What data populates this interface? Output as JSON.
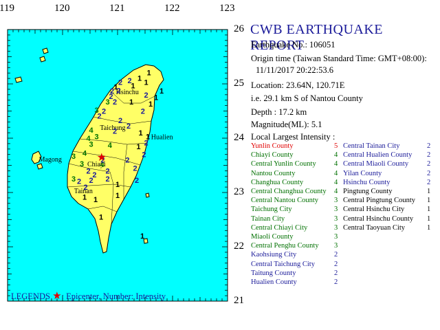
{
  "axes": {
    "longitudes": [
      "119",
      "120",
      "121",
      "122",
      "123"
    ],
    "latitudes": [
      "26",
      "25",
      "24",
      "23",
      "22",
      "21"
    ]
  },
  "report": {
    "title": "CWB EARTHQUAKE REPORT",
    "earthquake_no": "Earthquake No.: 106051",
    "origin_time_label": "Origin time (Taiwan Standard Time: GMT+08:00):",
    "origin_time": "11/11/2017 20:22:53.6",
    "location": "Location: 23.64N, 120.71E",
    "relative_location": "i.e. 29.1 km S of Nantou County",
    "depth": "Depth : 17.2 km",
    "magnitude": "Magnitude(ML): 5.1",
    "intensity_header": "Local Largest Intensity :"
  },
  "colors": {
    "sea": "#00ffff",
    "land": "#ffff66",
    "max_intensity": "#e00000",
    "intensity_4": "#007000",
    "intensity_3": "#007000",
    "intensity_2": "#1a1a99",
    "intensity_1": "#000000"
  },
  "intensities_left": [
    {
      "name": "Yunlin County",
      "value": "5",
      "level": 5
    },
    {
      "name": "Chiayi County",
      "value": "4",
      "level": 4
    },
    {
      "name": "Central Yunlin County",
      "value": "4",
      "level": 4
    },
    {
      "name": "Nantou County",
      "value": "4",
      "level": 4
    },
    {
      "name": "Changhua County",
      "value": "4",
      "level": 4
    },
    {
      "name": "Central Changhua County",
      "value": "4",
      "level": 4
    },
    {
      "name": "Central Nantou County",
      "value": "3",
      "level": 3
    },
    {
      "name": "Taichung City",
      "value": "3",
      "level": 3
    },
    {
      "name": "Tainan City",
      "value": "3",
      "level": 3
    },
    {
      "name": "Central Chiayi City",
      "value": "3",
      "level": 3
    },
    {
      "name": "Miaoli County",
      "value": "3",
      "level": 3
    },
    {
      "name": "Central Penghu County",
      "value": "3",
      "level": 3
    },
    {
      "name": "Kaohsiung City",
      "value": "2",
      "level": 2
    },
    {
      "name": "Central Taichung City",
      "value": "2",
      "level": 2
    },
    {
      "name": "Taitung County",
      "value": "2",
      "level": 2
    },
    {
      "name": "Hualien County",
      "value": "2",
      "level": 2
    }
  ],
  "intensities_right": [
    {
      "name": "Central Tainan City",
      "value": "2",
      "level": 2
    },
    {
      "name": "Central Hualien County",
      "value": "2",
      "level": 2
    },
    {
      "name": "Central Miaoli County",
      "value": "2",
      "level": 2
    },
    {
      "name": "Yilan County",
      "value": "2",
      "level": 2
    },
    {
      "name": "Hsinchu County",
      "value": "2",
      "level": 2
    },
    {
      "name": "Pingtung County",
      "value": "1",
      "level": 1
    },
    {
      "name": "Central Pingtung County",
      "value": "1",
      "level": 1
    },
    {
      "name": "Central Hsinchu City",
      "value": "1",
      "level": 1
    },
    {
      "name": "Central Hsinchu County",
      "value": "1",
      "level": 1
    },
    {
      "name": "Central Taoyuan City",
      "value": "1",
      "level": 1
    }
  ],
  "legend": {
    "prefix": "LEGENDS",
    "text": ": Epicenter, Number: Intensity"
  },
  "map_labels": [
    {
      "text": "Hsinchu",
      "lon": 120.97,
      "lat": 24.81
    },
    {
      "text": "Taichung",
      "lon": 120.68,
      "lat": 24.15
    },
    {
      "text": "Hualien",
      "lon": 121.61,
      "lat": 23.98
    },
    {
      "text": "Magong",
      "lon": 119.57,
      "lat": 23.57
    },
    {
      "text": "Chiayi",
      "lon": 120.45,
      "lat": 23.48
    },
    {
      "text": "Tainan",
      "lon": 120.21,
      "lat": 22.99
    }
  ],
  "epicenter": {
    "lon": 120.71,
    "lat": 23.64
  },
  "stations": [
    {
      "v": "1",
      "lon": 121.57,
      "lat": 25.16
    },
    {
      "v": "1",
      "lon": 121.4,
      "lat": 25.06
    },
    {
      "v": "1",
      "lon": 121.52,
      "lat": 24.98
    },
    {
      "v": "2",
      "lon": 121.22,
      "lat": 25.01
    },
    {
      "v": "1",
      "lon": 121.28,
      "lat": 24.92
    },
    {
      "v": "1",
      "lon": 120.97,
      "lat": 24.9
    },
    {
      "v": "2",
      "lon": 121.02,
      "lat": 24.83
    },
    {
      "v": "2",
      "lon": 120.9,
      "lat": 24.82
    },
    {
      "v": "3",
      "lon": 120.82,
      "lat": 24.62
    },
    {
      "v": "2",
      "lon": 120.88,
      "lat": 24.72
    },
    {
      "v": "2",
      "lon": 120.95,
      "lat": 24.62
    },
    {
      "v": "1",
      "lon": 121.25,
      "lat": 24.62
    },
    {
      "v": "2",
      "lon": 121.52,
      "lat": 24.75
    },
    {
      "v": "1",
      "lon": 121.7,
      "lat": 24.7
    },
    {
      "v": "1",
      "lon": 121.6,
      "lat": 24.58
    },
    {
      "v": "2",
      "lon": 121.46,
      "lat": 24.45
    },
    {
      "v": "1",
      "lon": 121.8,
      "lat": 24.82
    },
    {
      "v": "3",
      "lon": 120.62,
      "lat": 24.47
    },
    {
      "v": "2",
      "lon": 120.75,
      "lat": 24.45
    },
    {
      "v": "2",
      "lon": 120.67,
      "lat": 24.36
    },
    {
      "v": "4",
      "lon": 120.52,
      "lat": 24.1
    },
    {
      "v": "4",
      "lon": 120.47,
      "lat": 23.95
    },
    {
      "v": "3",
      "lon": 120.62,
      "lat": 23.98
    },
    {
      "v": "2",
      "lon": 120.95,
      "lat": 24.08
    },
    {
      "v": "2",
      "lon": 121.05,
      "lat": 24.28
    },
    {
      "v": "2",
      "lon": 121.2,
      "lat": 24.18
    },
    {
      "v": "1",
      "lon": 121.42,
      "lat": 24.05
    },
    {
      "v": "2",
      "lon": 121.52,
      "lat": 23.87
    },
    {
      "v": "2",
      "lon": 121.48,
      "lat": 23.65
    },
    {
      "v": "1",
      "lon": 121.55,
      "lat": 23.98
    },
    {
      "v": "1",
      "lon": 121.38,
      "lat": 23.8
    },
    {
      "v": "2",
      "lon": 121.32,
      "lat": 23.4
    },
    {
      "v": "2",
      "lon": 121.35,
      "lat": 23.18
    },
    {
      "v": "2",
      "lon": 121.18,
      "lat": 23.55
    },
    {
      "v": "4",
      "lon": 120.86,
      "lat": 23.82
    },
    {
      "v": "3",
      "lon": 120.52,
      "lat": 23.84
    },
    {
      "v": "4",
      "lon": 120.4,
      "lat": 23.68
    },
    {
      "v": "3",
      "lon": 120.2,
      "lat": 23.62
    },
    {
      "v": "3",
      "lon": 120.35,
      "lat": 23.48
    },
    {
      "v": "2",
      "lon": 120.47,
      "lat": 23.35
    },
    {
      "v": "4",
      "lon": 120.72,
      "lat": 23.47
    },
    {
      "v": "2",
      "lon": 120.58,
      "lat": 23.28
    },
    {
      "v": "3",
      "lon": 120.2,
      "lat": 23.2
    },
    {
      "v": "2",
      "lon": 120.3,
      "lat": 23.16
    },
    {
      "v": "2",
      "lon": 120.42,
      "lat": 23.05
    },
    {
      "v": "2",
      "lon": 120.52,
      "lat": 23.18
    },
    {
      "v": "2",
      "lon": 120.82,
      "lat": 23.2
    },
    {
      "v": "1",
      "lon": 121.0,
      "lat": 23.1
    },
    {
      "v": "1",
      "lon": 120.4,
      "lat": 22.87
    },
    {
      "v": "1",
      "lon": 120.6,
      "lat": 22.82
    },
    {
      "v": "1",
      "lon": 121.0,
      "lat": 22.9
    },
    {
      "v": "1",
      "lon": 120.7,
      "lat": 22.5
    },
    {
      "v": "1",
      "lon": 121.45,
      "lat": 22.15
    },
    {
      "v": "2",
      "lon": 121.05,
      "lat": 24.98
    },
    {
      "v": "2",
      "lon": 120.73,
      "lat": 23.55
    },
    {
      "v": "2",
      "lon": 120.82,
      "lat": 23.35
    }
  ]
}
